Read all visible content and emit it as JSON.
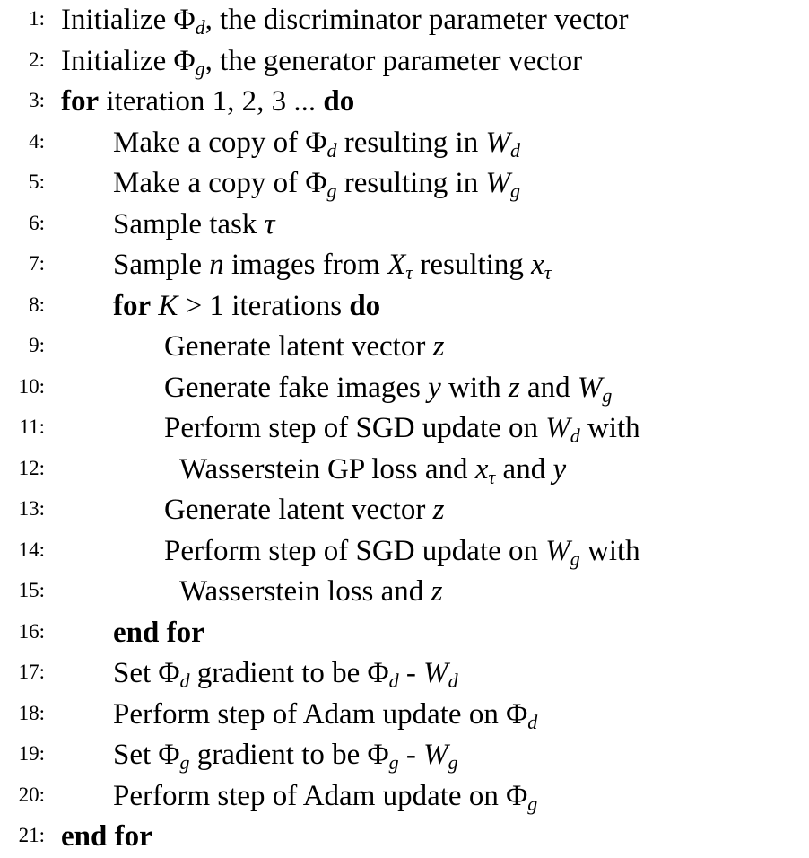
{
  "lines": [
    {
      "num": "1:",
      "indent": 0,
      "segs": [
        {
          "t": "Initialize "
        },
        {
          "t": "Φ"
        },
        {
          "t": "d",
          "sub": true
        },
        {
          "t": ", the discriminator parameter vector"
        }
      ]
    },
    {
      "num": "2:",
      "indent": 0,
      "segs": [
        {
          "t": "Initialize "
        },
        {
          "t": "Φ"
        },
        {
          "t": "g",
          "sub": true
        },
        {
          "t": ", the generator parameter vector"
        }
      ]
    },
    {
      "num": "3:",
      "indent": 0,
      "segs": [
        {
          "t": "for",
          "kw": true
        },
        {
          "t": " iteration 1, 2, 3 ... "
        },
        {
          "t": "do",
          "kw": true
        }
      ]
    },
    {
      "num": "4:",
      "indent": 1,
      "segs": [
        {
          "t": "Make a copy of "
        },
        {
          "t": "Φ"
        },
        {
          "t": "d",
          "sub": true
        },
        {
          "t": " resulting in "
        },
        {
          "t": "W",
          "m": true
        },
        {
          "t": "d",
          "sub": true
        }
      ]
    },
    {
      "num": "5:",
      "indent": 1,
      "segs": [
        {
          "t": "Make a copy of "
        },
        {
          "t": "Φ"
        },
        {
          "t": "g",
          "sub": true
        },
        {
          "t": " resulting in "
        },
        {
          "t": "W",
          "m": true
        },
        {
          "t": "g",
          "sub": true
        }
      ]
    },
    {
      "num": "6:",
      "indent": 1,
      "segs": [
        {
          "t": "Sample task "
        },
        {
          "t": "τ",
          "m": true
        }
      ]
    },
    {
      "num": "7:",
      "indent": 1,
      "segs": [
        {
          "t": "Sample "
        },
        {
          "t": "n",
          "m": true
        },
        {
          "t": " images from "
        },
        {
          "t": "X",
          "m": true
        },
        {
          "t": "τ",
          "sub": true
        },
        {
          "t": " resulting "
        },
        {
          "t": "x",
          "m": true
        },
        {
          "t": "τ",
          "sub": true
        }
      ]
    },
    {
      "num": "8:",
      "indent": 1,
      "segs": [
        {
          "t": "for",
          "kw": true
        },
        {
          "t": " "
        },
        {
          "t": "K",
          "m": true
        },
        {
          "t": " > 1 iterations "
        },
        {
          "t": "do",
          "kw": true
        }
      ]
    },
    {
      "num": "9:",
      "indent": 2,
      "segs": [
        {
          "t": "Generate latent vector "
        },
        {
          "t": "z",
          "m": true
        }
      ]
    },
    {
      "num": "10:",
      "indent": 2,
      "segs": [
        {
          "t": "Generate fake images "
        },
        {
          "t": "y",
          "m": true
        },
        {
          "t": " with "
        },
        {
          "t": "z",
          "m": true
        },
        {
          "t": " and "
        },
        {
          "t": "W",
          "m": true
        },
        {
          "t": "g",
          "sub": true
        }
      ]
    },
    {
      "num": "11:",
      "indent": 2,
      "segs": [
        {
          "t": "Perform step of SGD update on "
        },
        {
          "t": "W",
          "m": true
        },
        {
          "t": "d",
          "sub": true
        },
        {
          "t": " with"
        }
      ]
    },
    {
      "num": "12:",
      "indent": 3,
      "segs": [
        {
          "t": "Wasserstein GP loss and "
        },
        {
          "t": "x",
          "m": true
        },
        {
          "t": "τ",
          "sub": true
        },
        {
          "t": " and "
        },
        {
          "t": "y",
          "m": true
        }
      ]
    },
    {
      "num": "13:",
      "indent": 2,
      "segs": [
        {
          "t": "Generate latent vector "
        },
        {
          "t": "z",
          "m": true
        }
      ]
    },
    {
      "num": "14:",
      "indent": 2,
      "segs": [
        {
          "t": "Perform step of SGD update on "
        },
        {
          "t": "W",
          "m": true
        },
        {
          "t": "g",
          "sub": true
        },
        {
          "t": " with"
        }
      ]
    },
    {
      "num": "15:",
      "indent": 3,
      "segs": [
        {
          "t": "Wasserstein loss and "
        },
        {
          "t": "z",
          "m": true
        }
      ]
    },
    {
      "num": "16:",
      "indent": 1,
      "segs": [
        {
          "t": "end for",
          "kw": true
        }
      ]
    },
    {
      "num": "17:",
      "indent": 1,
      "segs": [
        {
          "t": "Set "
        },
        {
          "t": "Φ"
        },
        {
          "t": "d",
          "sub": true
        },
        {
          "t": " gradient to be "
        },
        {
          "t": "Φ"
        },
        {
          "t": "d",
          "sub": true
        },
        {
          "t": " - "
        },
        {
          "t": "W",
          "m": true
        },
        {
          "t": "d",
          "sub": true
        }
      ]
    },
    {
      "num": "18:",
      "indent": 1,
      "segs": [
        {
          "t": "Perform step of Adam update on "
        },
        {
          "t": "Φ"
        },
        {
          "t": "d",
          "sub": true
        }
      ]
    },
    {
      "num": "19:",
      "indent": 1,
      "segs": [
        {
          "t": "Set "
        },
        {
          "t": "Φ"
        },
        {
          "t": "g",
          "sub": true
        },
        {
          "t": " gradient to be "
        },
        {
          "t": "Φ"
        },
        {
          "t": "g",
          "sub": true
        },
        {
          "t": " - "
        },
        {
          "t": "W",
          "m": true
        },
        {
          "t": "g",
          "sub": true
        }
      ]
    },
    {
      "num": "20:",
      "indent": 1,
      "segs": [
        {
          "t": "Perform step of Adam update on "
        },
        {
          "t": "Φ"
        },
        {
          "t": "g",
          "sub": true
        }
      ]
    },
    {
      "num": "21:",
      "indent": 0,
      "segs": [
        {
          "t": "end for",
          "kw": true
        }
      ]
    }
  ]
}
